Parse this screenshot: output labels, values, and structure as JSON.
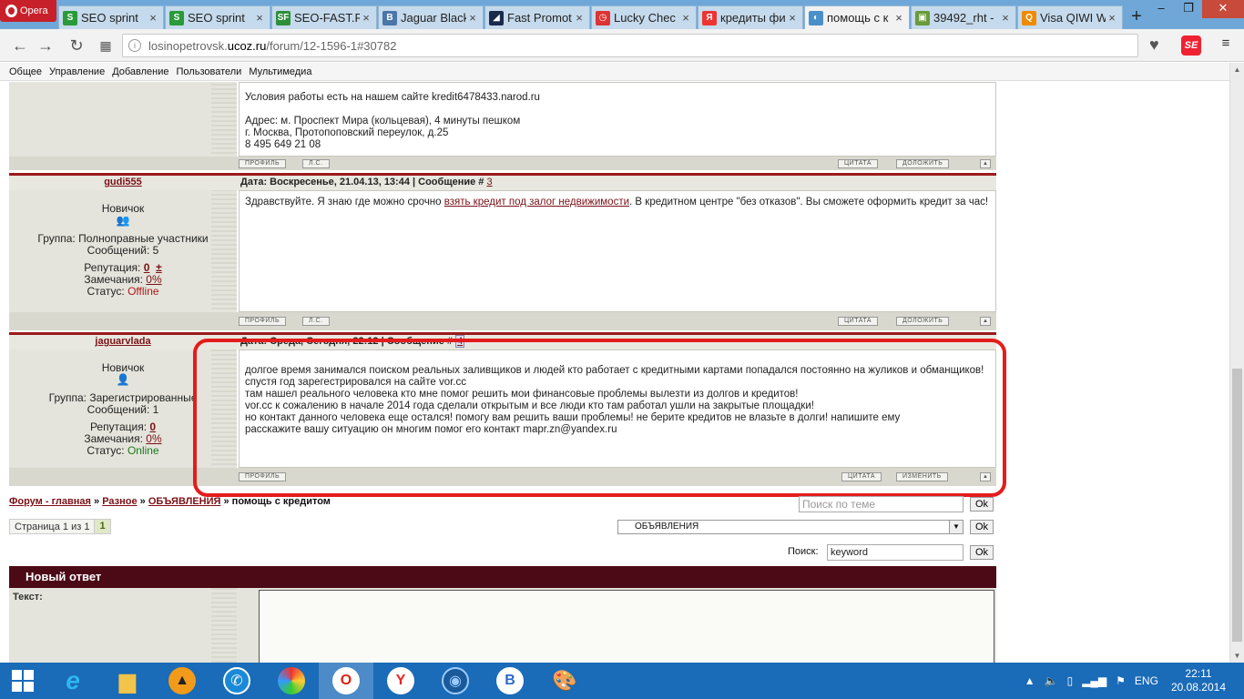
{
  "browser": {
    "menu_label": "Opera",
    "tabs": [
      {
        "label": "SEO sprint",
        "icon": "seosprint-icon",
        "color": "#2a9a3a",
        "glyph": "S"
      },
      {
        "label": "SEO sprint",
        "icon": "seosprint-icon",
        "color": "#2a9a3a",
        "glyph": "S"
      },
      {
        "label": "SEO-FAST.R",
        "icon": "seofast-icon",
        "color": "#2d8f3a",
        "glyph": "SF"
      },
      {
        "label": "Jaguar Black",
        "icon": "vk-icon",
        "color": "#4a76a8",
        "glyph": "B"
      },
      {
        "label": "Fast Promot",
        "icon": "fastpromo-icon",
        "color": "#1a2a4a",
        "glyph": "◢"
      },
      {
        "label": "Lucky Chec",
        "icon": "clock-icon",
        "color": "#d33",
        "glyph": "◷"
      },
      {
        "label": "кредиты фи",
        "icon": "yandex-icon",
        "color": "#e33",
        "glyph": "Я"
      },
      {
        "label": "помощь с к",
        "icon": "ucoz-icon",
        "color": "#4a90c8",
        "glyph": "◐",
        "active": true
      },
      {
        "label": "39492_rht -",
        "icon": "image-icon",
        "color": "#6a9a3a",
        "glyph": "▣"
      },
      {
        "label": "Visa QIWI W",
        "icon": "qiwi-icon",
        "color": "#f08a00",
        "glyph": "Q"
      }
    ],
    "url_prefix": "losinopetrovsk.",
    "url_domain": "ucoz.ru",
    "url_path": "/forum/12-1596-1#30782"
  },
  "ucoz_menu": [
    "Общее",
    "Управление",
    "Добавление",
    "Пользователи",
    "Мультимедиа"
  ],
  "buttons": {
    "profile": "ПРОФИЛЬ",
    "pm": "Л.С.",
    "quote": "ЦИТАТА",
    "report": "ДОЛОЖИТЬ",
    "edit": "ИЗМЕНИТЬ",
    "up": "▲"
  },
  "post_prev": {
    "lines": [
      "Условия работы есть на нашем сайте kredit6478433.narod.ru",
      "",
      "Адрес: м. Проспект Мира (кольцевая), 4 минуты пешком",
      "г. Москва, Протопоповский переулок, д.25",
      "8 495 649 21 08"
    ]
  },
  "post3": {
    "username": "gudi555",
    "info_prefix": "Дата: Воскресенье, 21.04.13, 13:44 | Сообщение #",
    "number": "3",
    "rank": "Новичок",
    "group": "Группа: Полноправные участники",
    "messages": "Сообщений: 5",
    "reputation_label": "Репутация:",
    "reputation": "0",
    "reputation_pm": "±",
    "warnings_label": "Замечания:",
    "warnings": "0%",
    "status_label": "Статус:",
    "status": "Offline",
    "text_before": "Здравствуйте. Я знаю где можно срочно ",
    "link": "взять кредит под залог недвижимости",
    "text_after": ". В кредитном центре \"без отказов\". Вы сможете оформить кредит за час!"
  },
  "post4": {
    "username": "jaguarvlada",
    "info_prefix": "Дата: Среда, Сегодня, 22:12 | Сообщение #",
    "number": "4",
    "rank": "Новичок",
    "group": "Группа: Зарегистрированные",
    "messages": "Сообщений: 1",
    "reputation_label": "Репутация:",
    "reputation": "0",
    "warnings_label": "Замечания:",
    "warnings": "0%",
    "status_label": "Статус:",
    "status": "Online",
    "lines": [
      "долгое время занимался поиском реальных заливщиков и людей кто работает с кредитными картами попадался постоянно на жуликов и обманщиков! спустя год зарегестрировался на сайте vor.cc",
      "там нашел реального человека кто мне помог решить мои финансовые проблемы вылезти из долгов и кредитов!",
      "vor.cc к сожалению в начале 2014 года сделали открытым и все люди кто там работал ушли на закрытые площадки!",
      "но контакт данного человека еще остался! помогу вам решить ваши проблемы! не берите кредитов не влазьте в долги! напишите ему",
      "расскажите вашу ситуацию он многим помог его контакт mapr.zn@yandex.ru"
    ]
  },
  "breadcrumbs": {
    "home": "Форум - главная",
    "sep": "»",
    "misc": "Разное",
    "section": "ОБЪЯВЛЕНИЯ",
    "current": "помощь с кредитом"
  },
  "topic_search_placeholder": "Поиск по теме",
  "ok": "Ok",
  "pager": {
    "label": "Страница 1 из 1",
    "current": "1"
  },
  "section_select": "ОБЪЯВЛЕНИЯ",
  "search": {
    "label": "Поиск:",
    "value": "keyword"
  },
  "reply": {
    "title": "Новый ответ",
    "text_label": "Текст:"
  },
  "taskbar": {
    "lang": "ENG",
    "time": "22:11",
    "date": "20.08.2014"
  }
}
